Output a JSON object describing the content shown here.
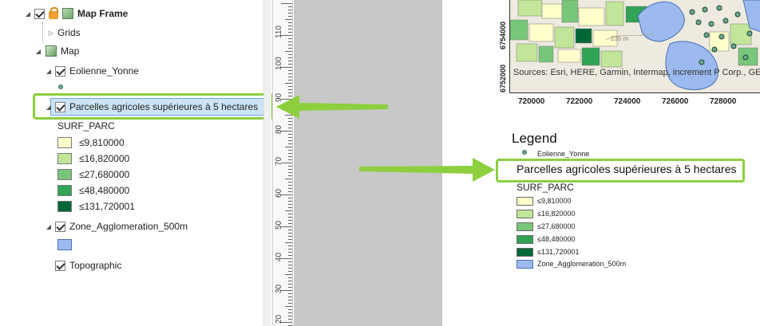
{
  "contents": {
    "map_frame_label": "Map Frame",
    "grids_label": "Grids",
    "map_label": "Map",
    "eolienne_label": "Eolienne_Yonne",
    "parcelles_label": "Parcelles agricoles supérieures à 5 hectares",
    "field_label": "SURF_PARC",
    "classes": [
      "≤9,810000",
      "≤16,820000",
      "≤27,680000",
      "≤48,480000",
      "≤131,720001"
    ],
    "zone_label": "Zone_Agglomeration_500m",
    "topographic_label": "Topographic"
  },
  "colors": {
    "classes": [
      "#ffffcc",
      "#c2e699",
      "#78c679",
      "#31a354",
      "#006837"
    ],
    "zone": "#9cbaf0",
    "highlight": "#8dcf3f",
    "selection": "#cce4f7"
  },
  "ruler": {
    "labels": [
      "110",
      "100",
      "90",
      "80",
      "70",
      "60",
      "50",
      "40",
      "30",
      "20"
    ]
  },
  "map": {
    "attribution": "Sources: Esri, HERE, Garmin, Intermap, increment P Corp., GEBCO, Esri Japan, METI, Esri China",
    "y_labels": [
      "6754000",
      "6752000"
    ],
    "x_labels": [
      "720000",
      "722000",
      "724000",
      "726000",
      "728000"
    ],
    "contour_label": "235 m"
  },
  "legend": {
    "title": "Legend",
    "eolienne_label": "Eolienne_Yonne",
    "layer_title": "Parcelles agricoles supérieures à 5 hectares",
    "field_label": "SURF_PARC",
    "classes": [
      "≤9,810000",
      "≤16,820000",
      "≤27,680000",
      "≤48,480000",
      "≤131,720001"
    ],
    "zone_label": "Zone_Agglomeration_500m"
  }
}
